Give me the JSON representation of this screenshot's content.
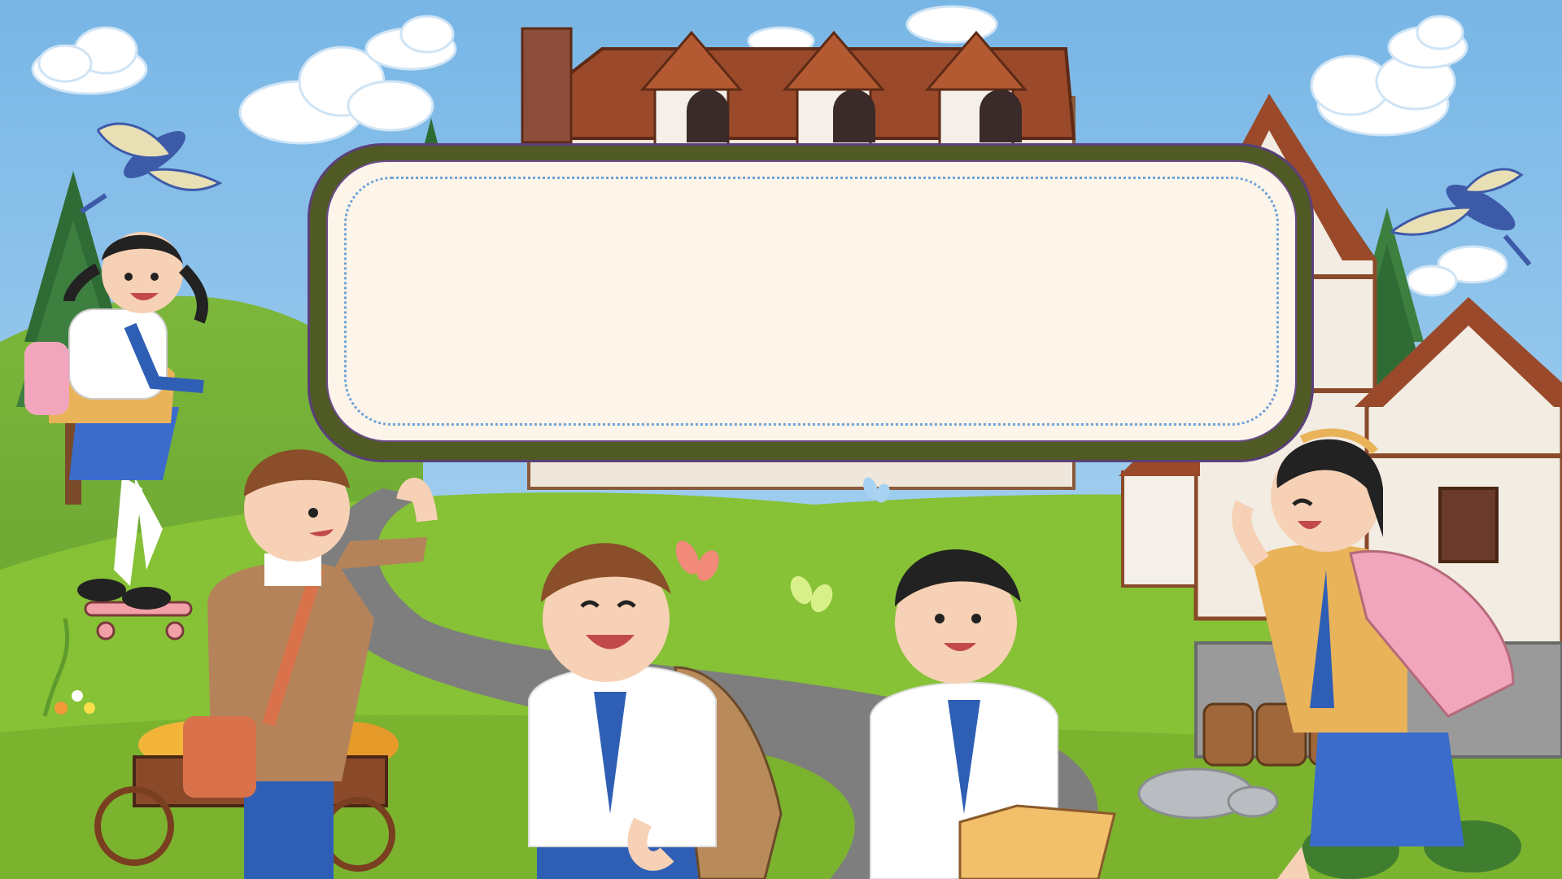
{
  "title_panel": {
    "text": ""
  },
  "palette": {
    "sky": "#7dbbe8",
    "hill_light": "#8dc43f",
    "hill_dark": "#6aa33a",
    "road": "#7d7d7d",
    "panel_border": "#4f5a24",
    "panel_fill": "#fdf4ea",
    "panel_dots": "#6fa3d6",
    "roof": "#9a4a2a",
    "shirt": "#ffffff",
    "tie": "#2f5fb5",
    "skirt": "#3b6ccc"
  },
  "icons": [
    "cloud-icon",
    "bird-icon",
    "butterfly-icon",
    "tree-icon",
    "house-icon",
    "barrel-icon",
    "cart-icon",
    "skateboard-icon",
    "book-icon",
    "backpack-icon"
  ]
}
